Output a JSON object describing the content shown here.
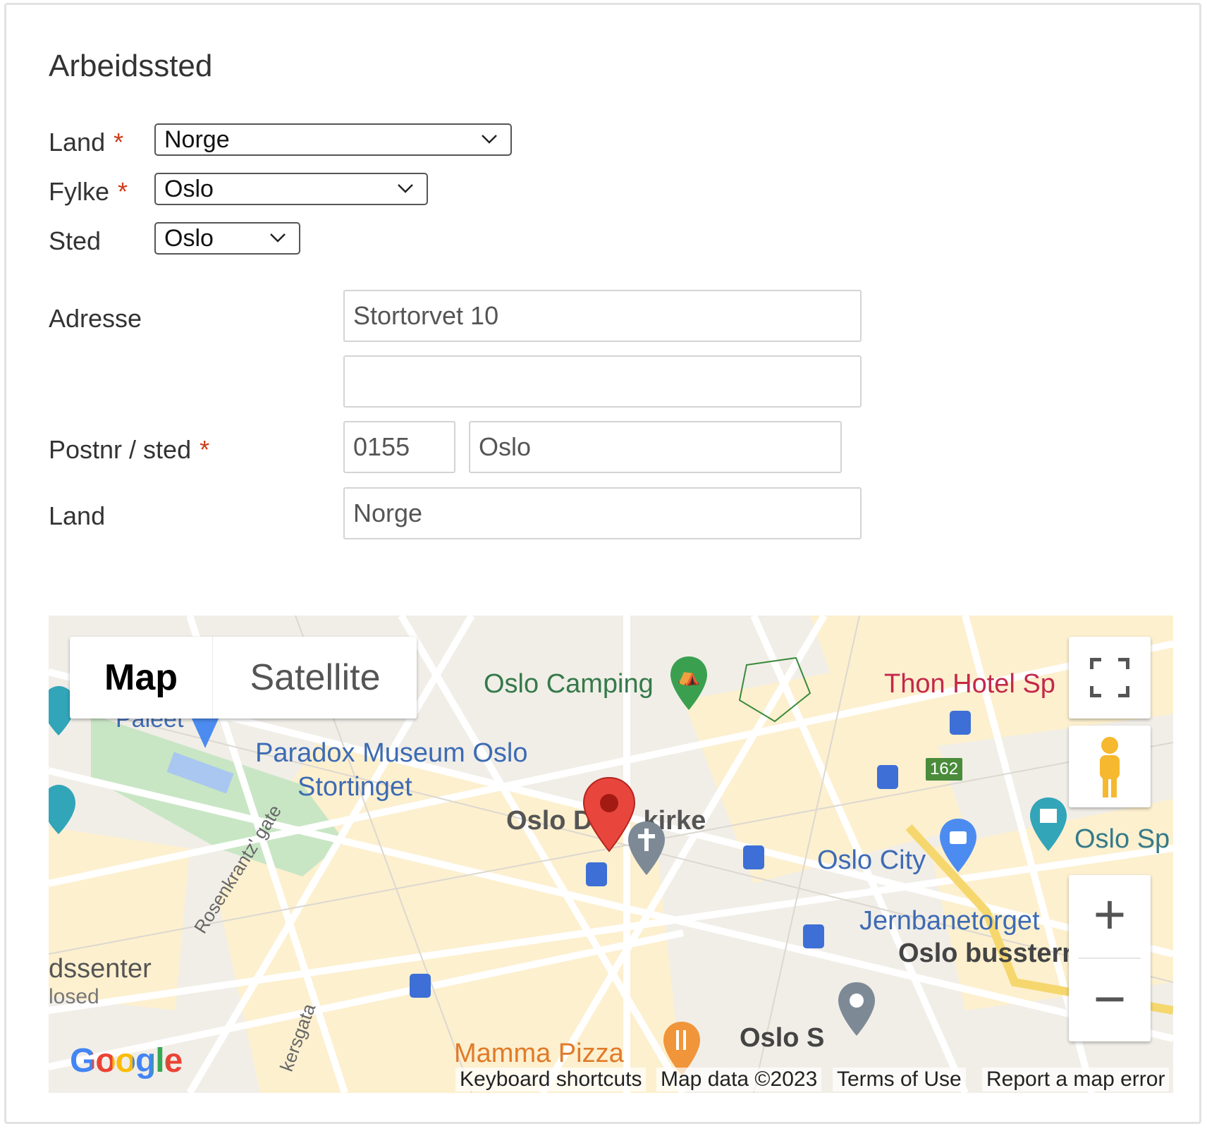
{
  "section": {
    "title": "Arbeidssted"
  },
  "location_selects": {
    "country": {
      "label": "Land",
      "value": "Norge"
    },
    "county": {
      "label": "Fylke",
      "value": "Oslo"
    },
    "place": {
      "label": "Sted",
      "value": "Oslo"
    },
    "required_marker": "*"
  },
  "address_form": {
    "address_label": "Adresse",
    "address_line1": "Stortorvet 10",
    "address_line2": "",
    "postal_label": "Postnr / sted",
    "postal_code": "0155",
    "postal_place": "Oslo",
    "country_label": "Land",
    "country_value": "Norge"
  },
  "map": {
    "type_buttons": {
      "map": "Map",
      "satellite": "Satellite"
    },
    "labels": {
      "oslo_camping": "Oslo Camping",
      "thon_hotel": "Thon Hotel Sp",
      "paleet": "Paleet",
      "paradox_museum": "Paradox Museum Oslo",
      "stortinget": "Stortinget",
      "oslo_domkirke_a": "Oslo D",
      "oslo_domkirke_b": "kirke",
      "oslo_city": "Oslo City",
      "oslo_sp": "Oslo Sp",
      "jernbanetorget": "Jernbanetorget",
      "oslo_bussterminal": "Oslo bussterr",
      "rosenkrantz_gate": "Rosenkrantz' gate",
      "kjopesenter": "dssenter",
      "closed": "losed",
      "kirkegata": "kersgata",
      "mamma_pizza": "Mamma Pizza",
      "oslo_s": "Oslo S",
      "bus_route": "162"
    },
    "google_logo": "Google",
    "footer": {
      "keyboard_shortcuts": "Keyboard shortcuts",
      "map_data": "Map data ©2023",
      "terms": "Terms of Use",
      "report": "Report a map error"
    },
    "controls": {
      "zoom_in": "+",
      "zoom_out": "−"
    },
    "colors": {
      "pin": "#d93a33",
      "label_green": "#357a4a",
      "label_blue": "#3d6bb3",
      "label_pink": "#c3294b"
    }
  }
}
